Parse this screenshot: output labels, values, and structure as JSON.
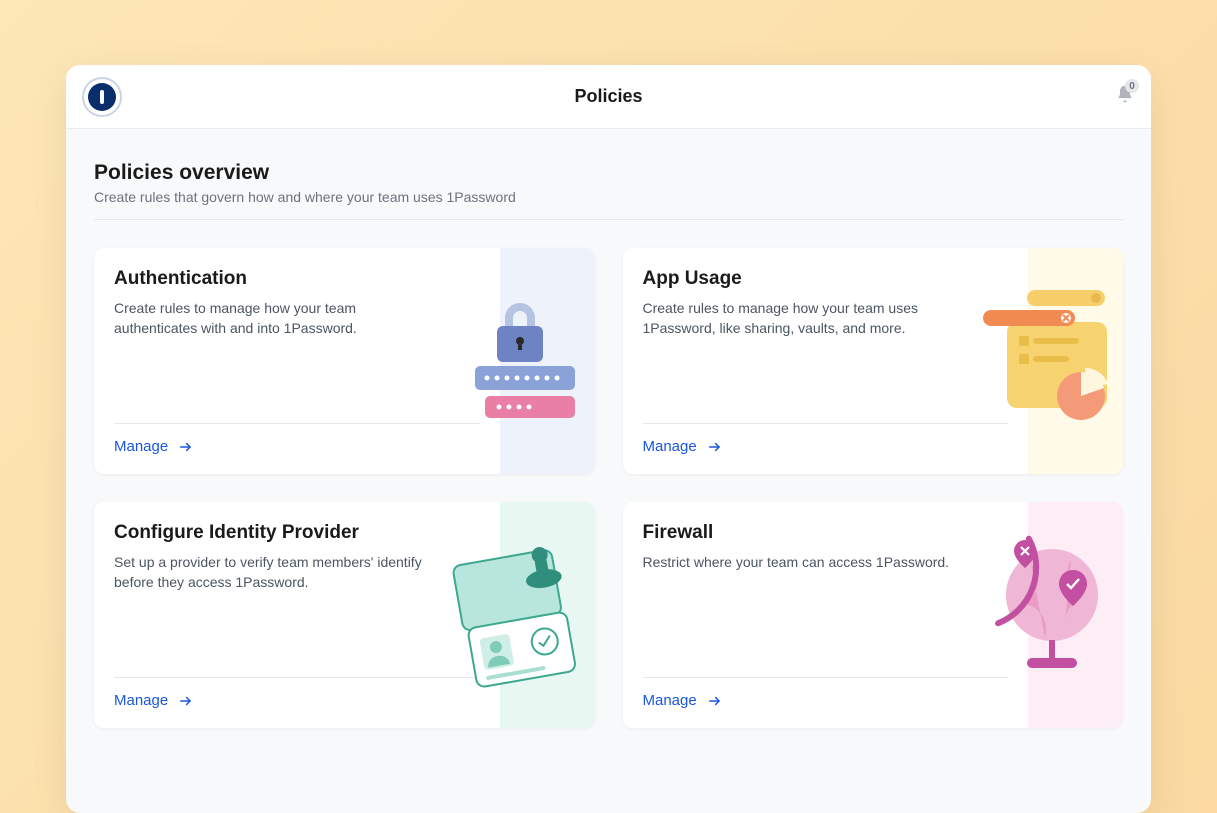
{
  "header": {
    "title": "Policies",
    "notification_count": "0"
  },
  "overview": {
    "title": "Policies overview",
    "subtitle": "Create rules that govern how and where your team uses 1Password"
  },
  "cards": {
    "authentication": {
      "title": "Authentication",
      "description": "Create rules to manage how your team authenticates with and into 1Password.",
      "action": "Manage"
    },
    "app_usage": {
      "title": "App Usage",
      "description": "Create rules to manage how your team uses 1Password, like sharing, vaults, and more.",
      "action": "Manage"
    },
    "idp": {
      "title": "Configure Identity Provider",
      "description": "Set up a provider to verify team members' identify before they access 1Password.",
      "action": "Manage"
    },
    "firewall": {
      "title": "Firewall",
      "description": "Restrict where your team can access 1Password.",
      "action": "Manage"
    }
  }
}
